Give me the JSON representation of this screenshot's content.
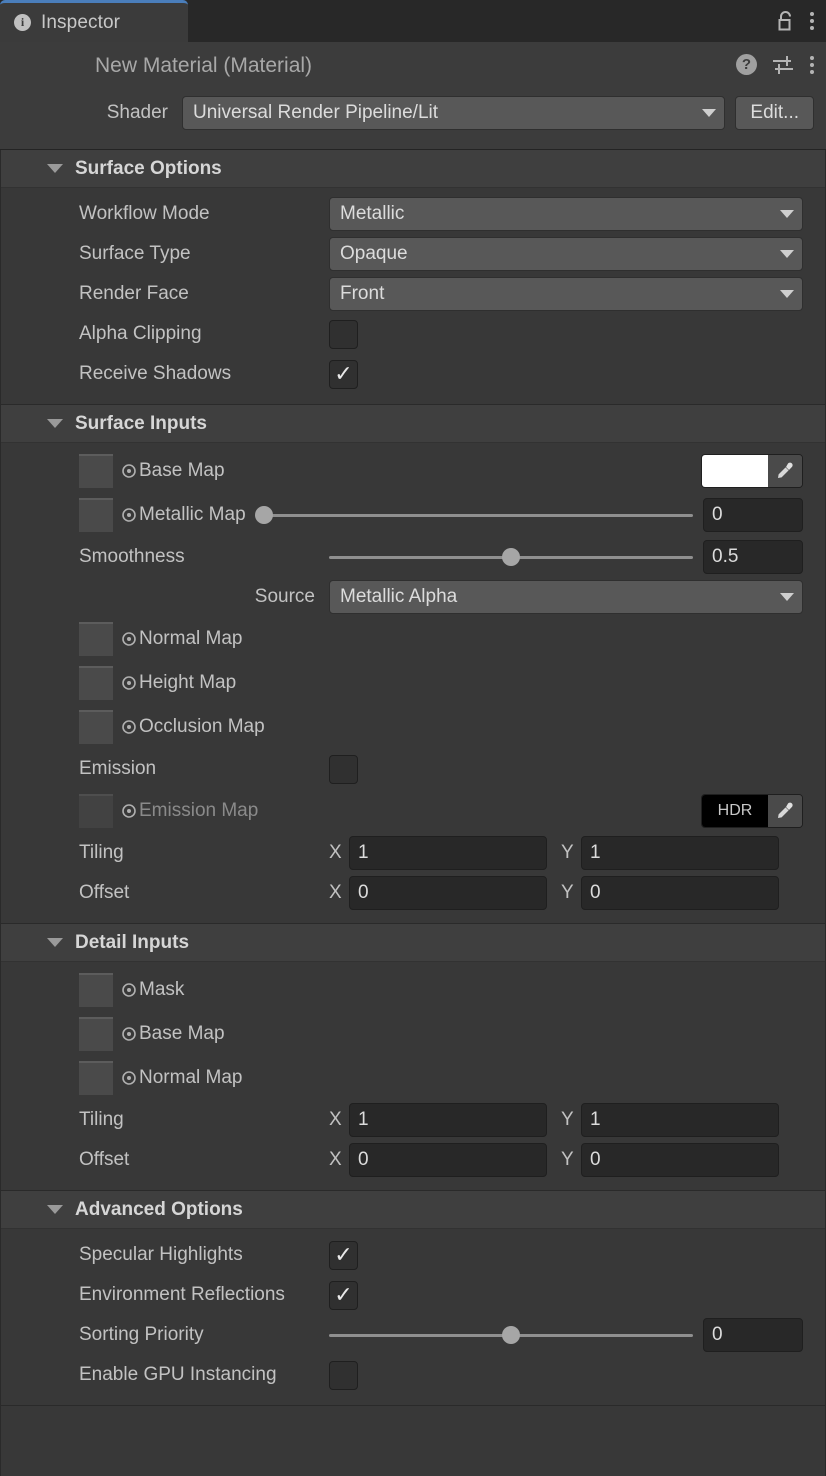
{
  "tab": {
    "label": "Inspector",
    "info_icon": "info-icon",
    "lock_icon": "lock-open-icon",
    "menu_icon": "kebab-menu-icon",
    "accent_color": "#4a7ebb"
  },
  "object_header": {
    "title": "New Material (Material)",
    "help_icon": "help-icon",
    "preset_icon": "preset-icon",
    "menu_icon": "kebab-menu-icon",
    "shader_label": "Shader",
    "shader_value": "Universal Render Pipeline/Lit",
    "edit_label": "Edit..."
  },
  "sections": [
    {
      "key": "surface_options",
      "title": "Surface Options",
      "expanded": true,
      "rows": [
        {
          "type": "dropdown",
          "label": "Workflow Mode",
          "value": "Metallic"
        },
        {
          "type": "dropdown",
          "label": "Surface Type",
          "value": "Opaque"
        },
        {
          "type": "dropdown",
          "label": "Render Face",
          "value": "Front"
        },
        {
          "type": "checkbox",
          "label": "Alpha Clipping",
          "checked": false
        },
        {
          "type": "checkbox",
          "label": "Receive Shadows",
          "checked": true
        }
      ]
    },
    {
      "key": "surface_inputs",
      "title": "Surface Inputs",
      "expanded": true,
      "rows": [
        {
          "type": "texture_color",
          "label": "Base Map",
          "color": "#ffffff",
          "hdr": false,
          "dim": false
        },
        {
          "type": "texture_slider",
          "label": "Metallic Map",
          "value": "0",
          "fraction": 0.0,
          "dim": false
        },
        {
          "type": "slider",
          "label": "Smoothness",
          "value": "0.5",
          "fraction": 0.5
        },
        {
          "type": "dropdown_right",
          "label": "Source",
          "value": "Metallic Alpha"
        },
        {
          "type": "texture",
          "label": "Normal Map",
          "dim": false
        },
        {
          "type": "texture",
          "label": "Height Map",
          "dim": false
        },
        {
          "type": "texture",
          "label": "Occlusion Map",
          "dim": false
        },
        {
          "type": "checkbox",
          "label": "Emission",
          "checked": false
        },
        {
          "type": "texture_color",
          "label": "Emission Map",
          "color": "#000000",
          "hdr": true,
          "hdr_label": "HDR",
          "dim": true
        },
        {
          "type": "vector2",
          "label": "Tiling",
          "x_axis": "X",
          "x": "1",
          "y_axis": "Y",
          "y": "1"
        },
        {
          "type": "vector2",
          "label": "Offset",
          "x_axis": "X",
          "x": "0",
          "y_axis": "Y",
          "y": "0"
        }
      ]
    },
    {
      "key": "detail_inputs",
      "title": "Detail Inputs",
      "expanded": true,
      "rows": [
        {
          "type": "texture",
          "label": "Mask",
          "dim": false
        },
        {
          "type": "texture",
          "label": "Base Map",
          "dim": false
        },
        {
          "type": "texture",
          "label": "Normal Map",
          "dim": false
        },
        {
          "type": "vector2",
          "label": "Tiling",
          "x_axis": "X",
          "x": "1",
          "y_axis": "Y",
          "y": "1"
        },
        {
          "type": "vector2",
          "label": "Offset",
          "x_axis": "X",
          "x": "0",
          "y_axis": "Y",
          "y": "0"
        }
      ]
    },
    {
      "key": "advanced_options",
      "title": "Advanced Options",
      "expanded": true,
      "rows": [
        {
          "type": "checkbox",
          "label": "Specular Highlights",
          "checked": true
        },
        {
          "type": "checkbox",
          "label": "Environment Reflections",
          "checked": true
        },
        {
          "type": "slider",
          "label": "Sorting Priority",
          "value": "0",
          "fraction": 0.5
        },
        {
          "type": "checkbox",
          "label": "Enable GPU Instancing",
          "checked": false
        }
      ]
    }
  ],
  "icons": {
    "target": "target-icon",
    "eyedropper": "eyedropper-icon",
    "caret": "chevron-down-icon",
    "triangle": "triangle-down-icon",
    "check": "check-icon"
  }
}
